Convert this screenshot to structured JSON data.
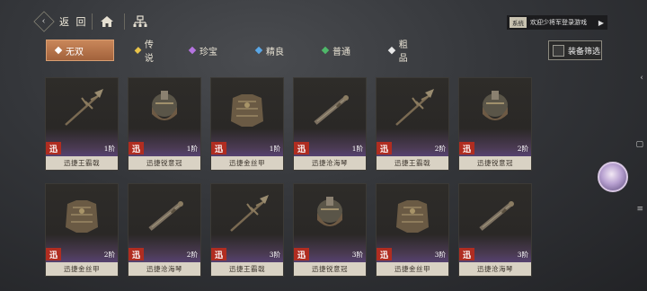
{
  "header": {
    "back_label": "返 回",
    "back_icon": "back-arrow-icon",
    "home_icon": "home-icon",
    "tree_icon": "hierarchy-icon",
    "notice_tag": "系统",
    "notice_text": "欢迎少将军登录游戏"
  },
  "tabs": [
    {
      "label": "无双",
      "color": "#ffffff",
      "active": true
    },
    {
      "label": "传说",
      "color": "#e8c34a",
      "active": false
    },
    {
      "label": "珍宝",
      "color": "#b574e0",
      "active": false
    },
    {
      "label": "精良",
      "color": "#5aa7e6",
      "active": false
    },
    {
      "label": "普通",
      "color": "#4fb86a",
      "active": false
    },
    {
      "label": "粗品",
      "color": "#e8e8e8",
      "active": false
    }
  ],
  "filter_label": "装备筛选",
  "badge_char": "迅",
  "colors": {
    "active_tab": "#b06f46",
    "badge": "#b02d21",
    "name_bar": "#d9d2c4"
  },
  "items": [
    {
      "name": "迅捷王霸戟",
      "level": "1阶",
      "kind": "spear"
    },
    {
      "name": "迅捷锐意冠",
      "level": "1阶",
      "kind": "helmet"
    },
    {
      "name": "迅捷金丝甲",
      "level": "1阶",
      "kind": "armor"
    },
    {
      "name": "迅捷沧海琴",
      "level": "1阶",
      "kind": "zither"
    },
    {
      "name": "迅捷王霸戟",
      "level": "2阶",
      "kind": "spear"
    },
    {
      "name": "迅捷锐意冠",
      "level": "2阶",
      "kind": "helmet"
    },
    {
      "name": "迅捷金丝甲",
      "level": "2阶",
      "kind": "armor"
    },
    {
      "name": "迅捷沧海琴",
      "level": "2阶",
      "kind": "zither"
    },
    {
      "name": "迅捷王霸戟",
      "level": "3阶",
      "kind": "spear"
    },
    {
      "name": "迅捷锐意冠",
      "level": "3阶",
      "kind": "helmet"
    },
    {
      "name": "迅捷金丝甲",
      "level": "3阶",
      "kind": "armor"
    },
    {
      "name": "迅捷沧海琴",
      "level": "3阶",
      "kind": "zither"
    }
  ]
}
